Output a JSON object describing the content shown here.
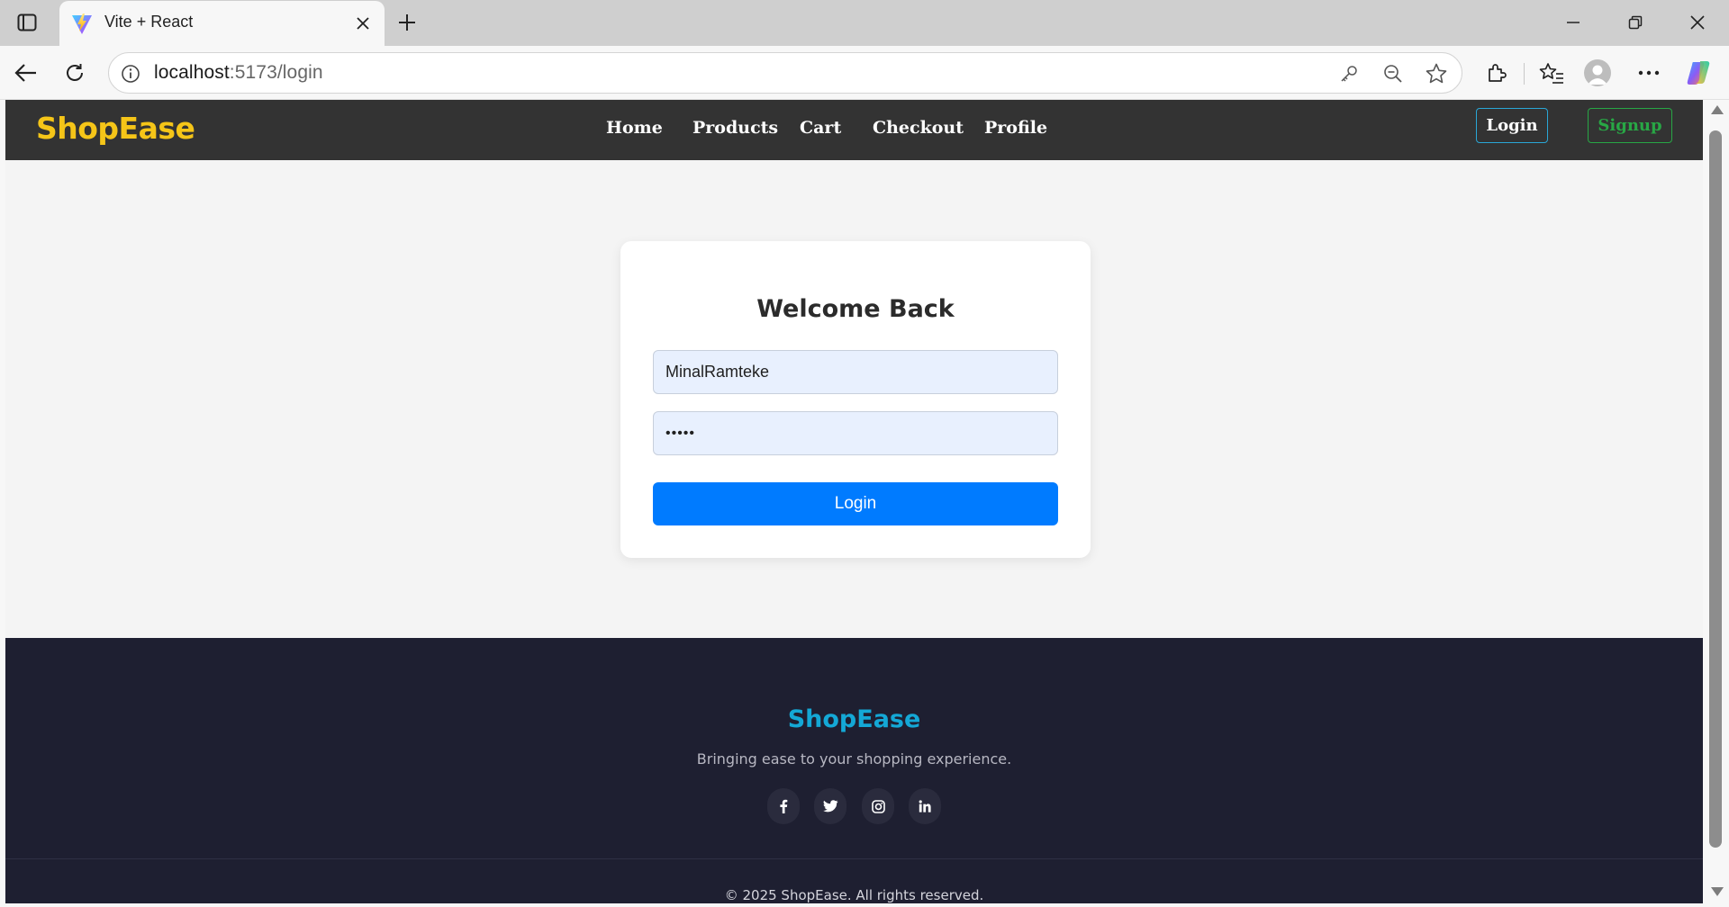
{
  "browser": {
    "tab_title": "Vite + React",
    "url_host": "localhost",
    "url_rest": ":5173/login"
  },
  "navbar": {
    "brand": "ShopEase",
    "links": [
      "Home",
      "Products",
      "Cart",
      "Checkout",
      "Profile"
    ],
    "login_label": "Login",
    "signup_label": "Signup"
  },
  "login_card": {
    "title": "Welcome Back",
    "username_value": "MinalRamteke",
    "password_value": "•••••",
    "submit_label": "Login"
  },
  "footer": {
    "brand": "ShopEase",
    "tagline": "Bringing ease to your shopping experience.",
    "social_icons": [
      "facebook-icon",
      "twitter-icon",
      "instagram-icon",
      "linkedin-icon"
    ],
    "copyright": "© 2025 ShopEase. All rights reserved."
  },
  "colors": {
    "brand_yellow": "#f5c518",
    "navbar_bg": "#333333",
    "primary_blue": "#007bff",
    "signup_green": "#28a745",
    "footer_bg": "#1e1f31",
    "footer_brand": "#14a8d6"
  }
}
